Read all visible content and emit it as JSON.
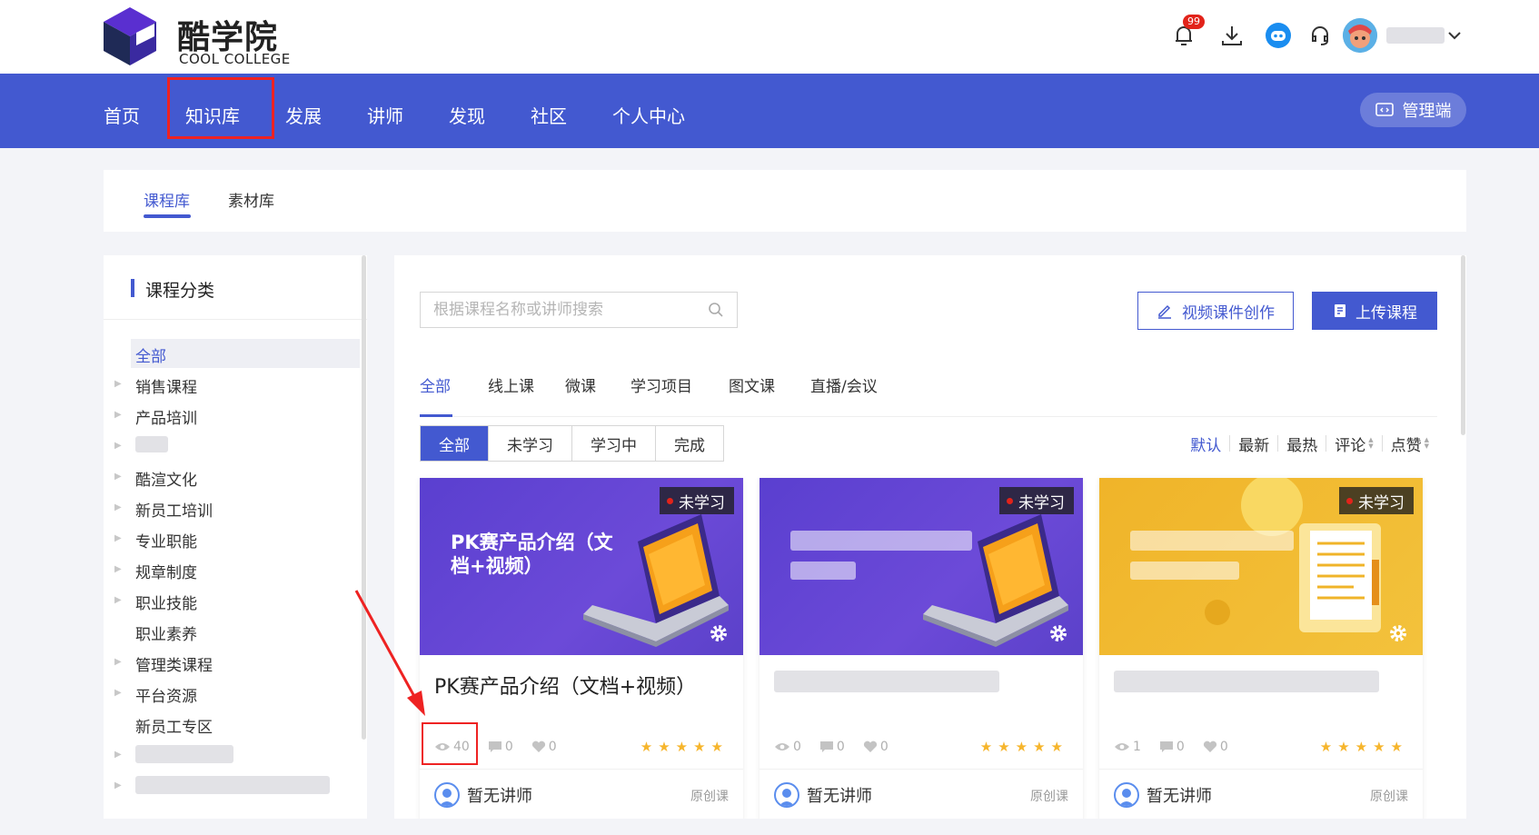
{
  "header": {
    "brand_cn": "酷学院",
    "brand_en": "COOL COLLEGE",
    "notification_count": "99",
    "colors": {
      "brand_blue": "#4359d0",
      "highlight_red": "#e22222"
    }
  },
  "nav": {
    "items": [
      "首页",
      "知识库",
      "发展",
      "讲师",
      "发现",
      "社区",
      "个人中心"
    ],
    "admin_label": "管理端"
  },
  "subtabs": [
    "课程库",
    "素材库"
  ],
  "sidebar": {
    "title": "课程分类",
    "categories": [
      "全部",
      "销售课程",
      "产品培训",
      "",
      "酷渲文化",
      "新员工培训",
      "专业职能",
      "规章制度",
      "职业技能",
      "职业素养",
      "管理类课程",
      "平台资源",
      "新员工专区",
      "",
      ""
    ]
  },
  "toolbar": {
    "search_placeholder": "根据课程名称或讲师搜索",
    "video_create_label": "视频课件创作",
    "upload_label": "上传课程"
  },
  "type_tabs": [
    "全部",
    "线上课",
    "微课",
    "学习项目",
    "图文课",
    "直播/会议"
  ],
  "status_filter": [
    "全部",
    "未学习",
    "学习中",
    "完成"
  ],
  "sorts": [
    "默认",
    "最新",
    "最热",
    "评论",
    "点赞"
  ],
  "cards": [
    {
      "cover_title": "PK赛产品介绍（文档+视频）",
      "status": "未学习",
      "title": "PK赛产品介绍（文档+视频）",
      "views": "40",
      "comments": "0",
      "likes": "0",
      "teacher": "暂无讲师",
      "origin": "原创课",
      "rating": 5
    },
    {
      "cover_title": "",
      "status": "未学习",
      "title": "",
      "views": "0",
      "comments": "0",
      "likes": "0",
      "teacher": "暂无讲师",
      "origin": "原创课",
      "rating": 5
    },
    {
      "cover_title": "",
      "status": "未学习",
      "title": "",
      "views": "1",
      "comments": "0",
      "likes": "0",
      "teacher": "暂无讲师",
      "origin": "原创课",
      "rating": 5
    }
  ]
}
